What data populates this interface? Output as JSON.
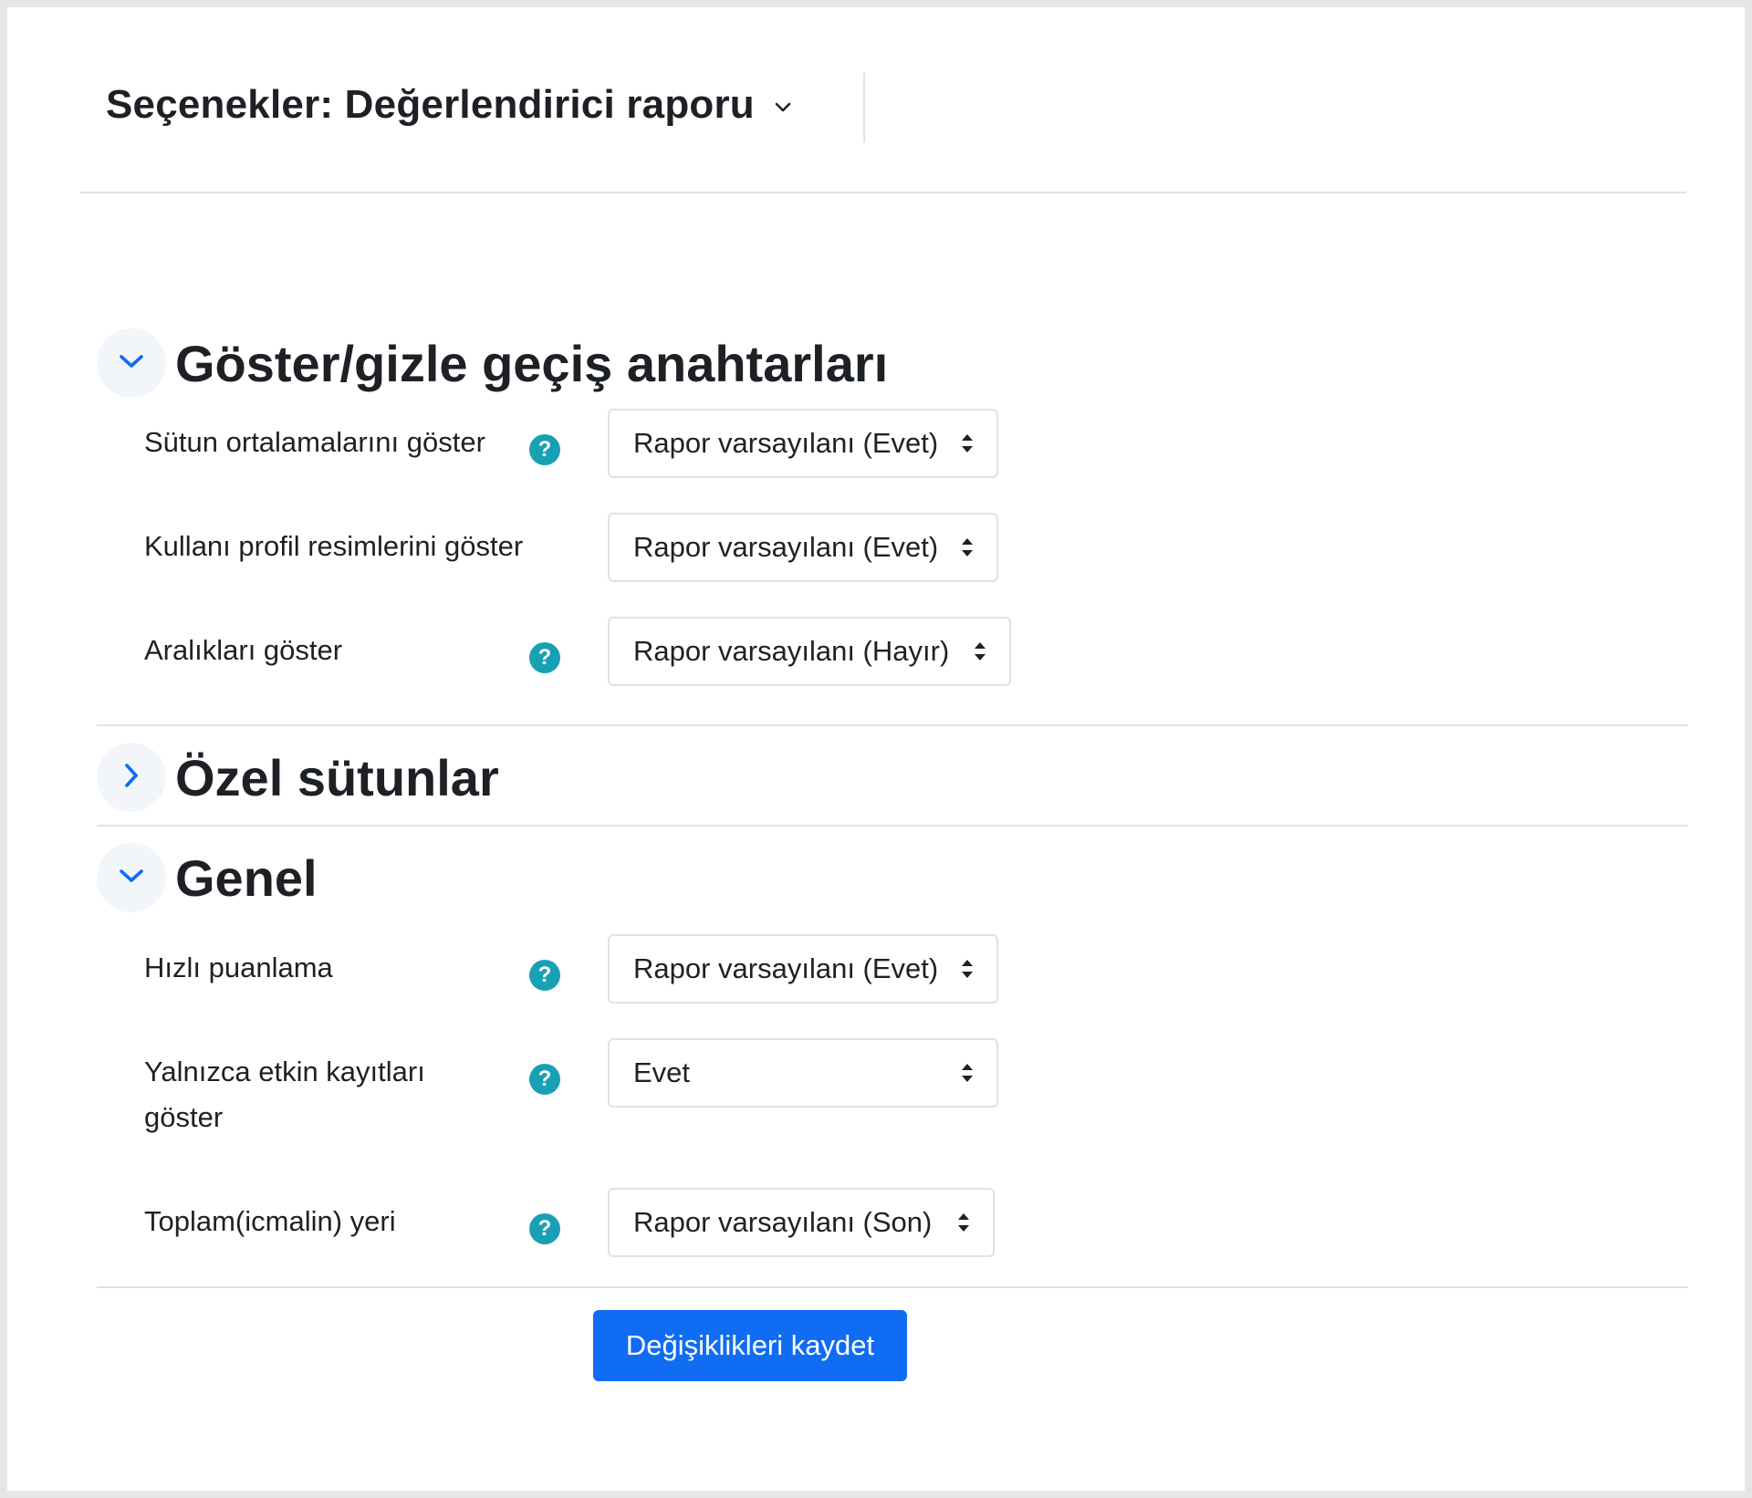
{
  "header": {
    "title": "Seçenekler: Değerlendirici raporu"
  },
  "sections": {
    "toggles": {
      "title": "Göster/gizle geçiş anahtarları",
      "expanded": true,
      "rows": [
        {
          "label": "Sütun ortalamalarını göster",
          "has_help": true,
          "value": "Rapor varsayılanı (Evet)"
        },
        {
          "label": "Kullanı profil resimlerini göster",
          "has_help": false,
          "value": "Rapor varsayılanı (Evet)"
        },
        {
          "label": "Aralıkları göster",
          "has_help": true,
          "value": "Rapor varsayılanı (Hayır)"
        }
      ]
    },
    "custom_columns": {
      "title": "Özel sütunlar",
      "expanded": false
    },
    "general": {
      "title": "Genel",
      "expanded": true,
      "rows": [
        {
          "label": "Hızlı puanlama",
          "has_help": true,
          "value": "Rapor varsayılanı (Evet)"
        },
        {
          "label_line1": "Yalnızca etkin kayıtları",
          "label_line2": "göster",
          "has_help": true,
          "value": "Evet"
        },
        {
          "label": "Toplam(icmalin) yeri",
          "has_help": true,
          "value": "Rapor varsayılanı (Son)"
        }
      ]
    }
  },
  "help_glyph": "?",
  "submit_label": "Değişiklikleri kaydet",
  "colors": {
    "primary": "#0f6cf3",
    "help": "#1aa0b4",
    "chevron": "#0f6cf3",
    "border": "#dee2e6"
  },
  "icons": {
    "header_dropdown": "chevron-down-icon",
    "section_expanded": "chevron-down-icon",
    "section_collapsed": "chevron-right-icon",
    "help": "question-circle-icon",
    "select_arrows": "sort-arrows-icon"
  }
}
